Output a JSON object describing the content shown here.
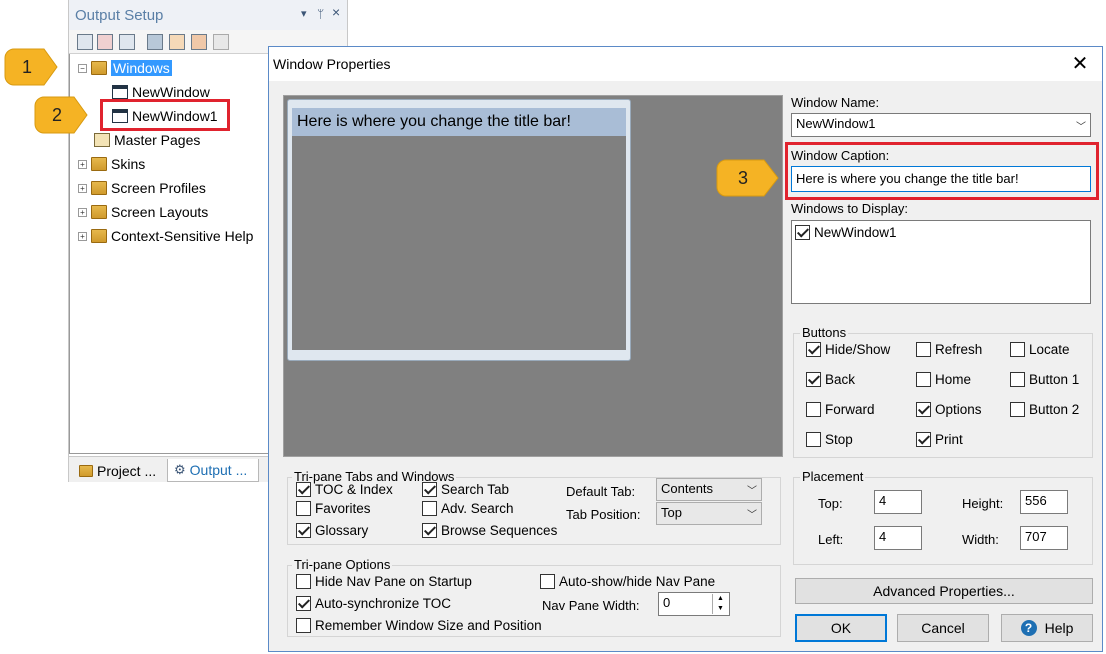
{
  "output_panel": {
    "title": "Output Setup",
    "pin_glyph": "▾",
    "dock_glyph": "ꟷ",
    "close_glyph": "×",
    "tree": [
      {
        "label": "Windows",
        "expander": "−",
        "icon": "windows-folder-icon",
        "selected": true
      },
      {
        "label": "NewWindow",
        "icon": "window-icon"
      },
      {
        "label": "NewWindow1",
        "icon": "window-icon"
      },
      {
        "label": "Master Pages",
        "icon": "master-pages-icon"
      },
      {
        "label": "Skins",
        "expander": "+",
        "icon": "skins-folder-icon"
      },
      {
        "label": "Screen Profiles",
        "expander": "+",
        "icon": "screen-profiles-icon"
      },
      {
        "label": "Screen Layouts",
        "expander": "+",
        "icon": "screen-layouts-icon"
      },
      {
        "label": "Context-Sensitive Help",
        "expander": "+",
        "icon": "context-help-icon"
      }
    ],
    "tabs": [
      {
        "label": "Project ..."
      },
      {
        "label": "Output ..."
      }
    ]
  },
  "callouts": [
    "1",
    "2",
    "3"
  ],
  "dialog": {
    "title": "Window Properties",
    "close_glyph": "✕",
    "preview_caption": "Here is where you change the title bar!",
    "window_name_label": "Window Name:",
    "window_name_value": "NewWindow1",
    "window_caption_label": "Window Caption:",
    "window_caption_value": "Here is where you change the title bar!",
    "windows_to_display_label": "Windows to Display:",
    "windows_to_display": [
      {
        "label": "NewWindow1",
        "checked": true
      }
    ],
    "buttons_group": {
      "title": "Buttons",
      "items": [
        {
          "label": "Hide/Show",
          "checked": true
        },
        {
          "label": "Refresh",
          "checked": false
        },
        {
          "label": "Locate",
          "checked": false
        },
        {
          "label": "Back",
          "checked": true
        },
        {
          "label": "Home",
          "checked": false
        },
        {
          "label": "Button 1",
          "checked": false
        },
        {
          "label": "Forward",
          "checked": false
        },
        {
          "label": "Options",
          "checked": true
        },
        {
          "label": "Button 2",
          "checked": false
        },
        {
          "label": "Stop",
          "checked": false
        },
        {
          "label": "Print",
          "checked": true
        }
      ]
    },
    "placement": {
      "title": "Placement",
      "top_label": "Top:",
      "top_value": "4",
      "height_label": "Height:",
      "height_value": "556",
      "left_label": "Left:",
      "left_value": "4",
      "width_label": "Width:",
      "width_value": "707"
    },
    "tripane_tabs": {
      "title": "Tri-pane Tabs and Windows",
      "items": [
        {
          "label": "TOC & Index",
          "checked": true
        },
        {
          "label": "Search Tab",
          "checked": true
        },
        {
          "label": "Favorites",
          "checked": false
        },
        {
          "label": "Adv. Search",
          "checked": false
        },
        {
          "label": "Glossary",
          "checked": true
        },
        {
          "label": "Browse Sequences",
          "checked": true
        }
      ],
      "default_tab_label": "Default Tab:",
      "default_tab_value": "Contents",
      "tab_position_label": "Tab Position:",
      "tab_position_value": "Top"
    },
    "tripane_options": {
      "title": "Tri-pane Options",
      "items": [
        {
          "label": "Hide Nav Pane on Startup",
          "checked": false
        },
        {
          "label": "Auto-show/hide Nav Pane",
          "checked": false
        },
        {
          "label": "Auto-synchronize TOC",
          "checked": true
        },
        {
          "label": "Remember Window Size and Position",
          "checked": false
        }
      ],
      "nav_pane_width_label": "Nav Pane Width:",
      "nav_pane_width_value": "0"
    },
    "advanced_button": "Advanced Properties...",
    "ok_button": "OK",
    "cancel_button": "Cancel",
    "help_button": "Help",
    "help_glyph": "?"
  },
  "colors": {
    "selection": "#3399ff",
    "callout_fill": "#f5b324",
    "highlight_box": "#e0232e",
    "preview_bg": "#808080"
  }
}
